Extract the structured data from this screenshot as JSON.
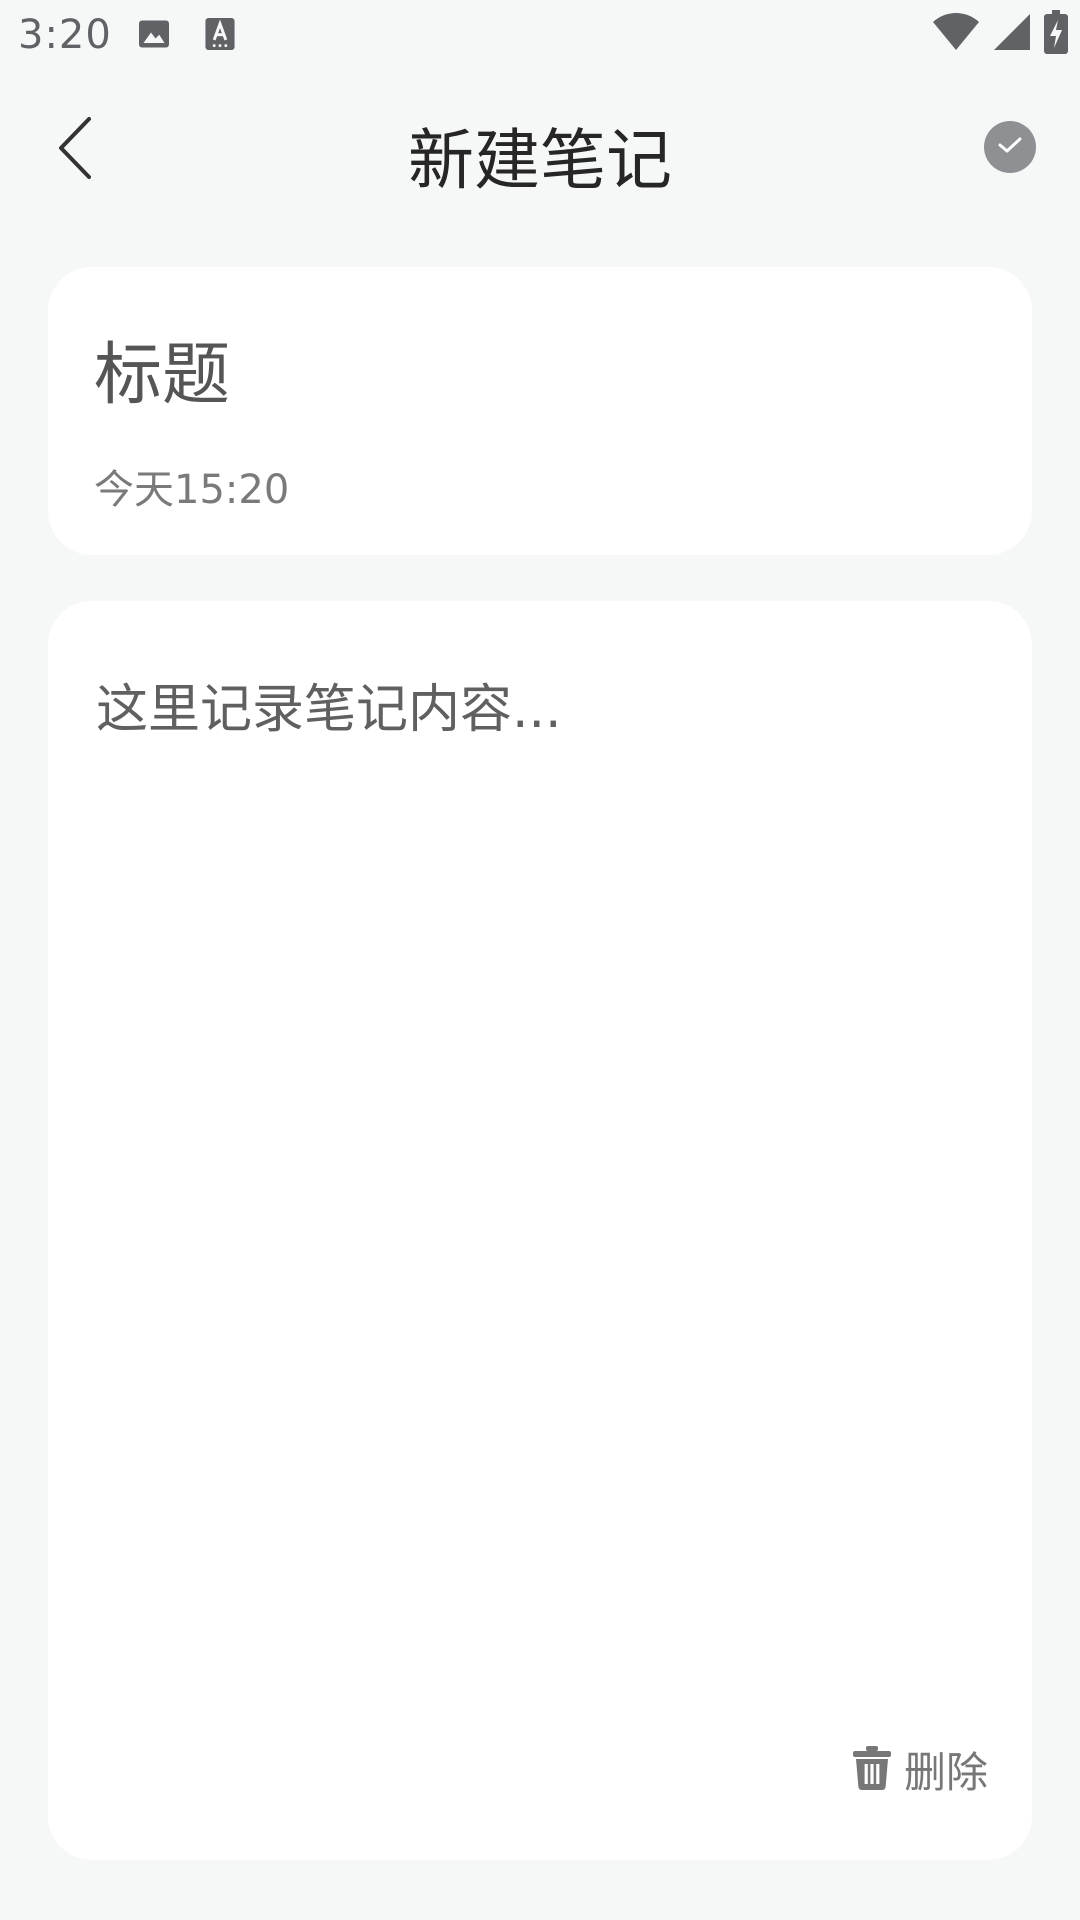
{
  "status_bar": {
    "time": "3:20",
    "icons_left": [
      "image-icon",
      "keyboard-a-icon"
    ],
    "icons_right": [
      "wifi-icon",
      "signal-icon",
      "battery-charging-icon"
    ]
  },
  "header": {
    "title": "新建笔记",
    "back_icon": "chevron-left-icon",
    "confirm_icon": "check-circle-icon"
  },
  "title_card": {
    "placeholder": "标题",
    "date": "今天15:20"
  },
  "content_card": {
    "placeholder": "这里记录笔记内容...",
    "delete_label": "删除",
    "delete_icon": "trash-icon"
  },
  "colors": {
    "background": "#F6F8F8",
    "card": "#FFFFFF",
    "title_text": "#262626",
    "muted_text": "#777777",
    "confirm_button": "#8E9193"
  }
}
